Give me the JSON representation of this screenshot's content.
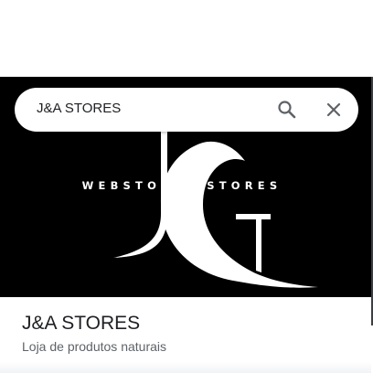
{
  "search": {
    "query": "J&A STORES"
  },
  "hero": {
    "logo_monogram": "JG",
    "logo_text": "WEBSTORES.STORES"
  },
  "place": {
    "name": "J&A STORES",
    "description": "Loja de produtos naturais"
  },
  "icons": {
    "search": "search-icon",
    "close": "close-icon"
  },
  "colors": {
    "hero_background": "#000000",
    "text_primary": "#202124",
    "text_secondary": "#5f6368",
    "icon": "#5f6368"
  }
}
